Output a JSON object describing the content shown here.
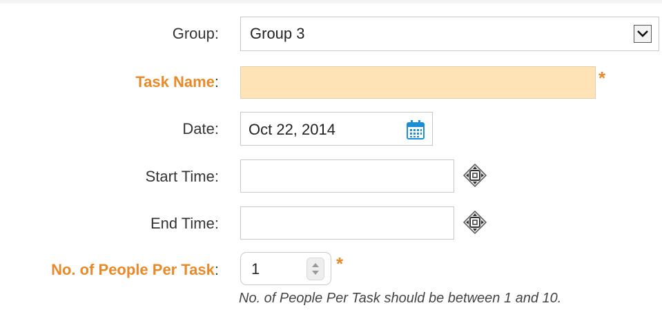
{
  "form": {
    "group": {
      "label": "Group",
      "colon": ":",
      "value": "Group 3"
    },
    "task_name": {
      "label": "Task Name",
      "colon": ":",
      "value": "",
      "required_mark": "*"
    },
    "date": {
      "label": "Date",
      "colon": ":",
      "value": "Oct 22, 2014"
    },
    "start_time": {
      "label": "Start Time",
      "colon": ":",
      "value": ""
    },
    "end_time": {
      "label": "End Time",
      "colon": ":",
      "value": ""
    },
    "people_per_task": {
      "label": "No. of People Per Task",
      "colon": ":",
      "value": "1",
      "required_mark": "*",
      "hint": "No. of People Per Task should be between 1 and 10."
    }
  },
  "icons": {
    "dropdown": "chevron-down-icon",
    "calendar": "calendar-icon",
    "time_picker": "time-picker-icon",
    "spinner": "spinner-arrows-icon"
  },
  "colors": {
    "required_label": "#e8892a",
    "required_field_bg": "#fde3b5",
    "calendar_icon": "#1a8fd6"
  }
}
